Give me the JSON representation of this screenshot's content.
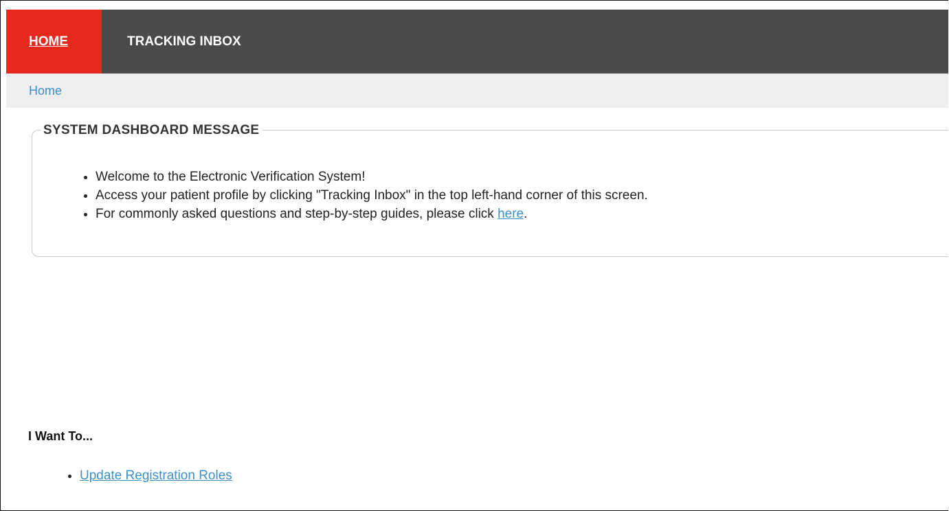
{
  "nav": {
    "tabs": [
      {
        "label": "HOME",
        "active": true
      },
      {
        "label": "TRACKING INBOX",
        "active": false
      }
    ]
  },
  "breadcrumb": {
    "items": [
      "Home"
    ]
  },
  "dashboard": {
    "title": "SYSTEM DASHBOARD MESSAGE",
    "messages": [
      "Welcome to the Electronic Verification System!",
      "Access your patient profile by clicking \"Tracking Inbox\" in the top left-hand corner of this screen."
    ],
    "guide_text": "For commonly asked questions and step-by-step guides, please click ",
    "guide_link": "here",
    "guide_suffix": "."
  },
  "iwant": {
    "title": "I Want To...",
    "links": [
      "Update Registration Roles"
    ]
  },
  "colors": {
    "nav_bg": "#4a4a4a",
    "active_tab": "#e5291c",
    "link": "#3b8ec6",
    "breadcrumb_bg": "#eeeeee"
  }
}
